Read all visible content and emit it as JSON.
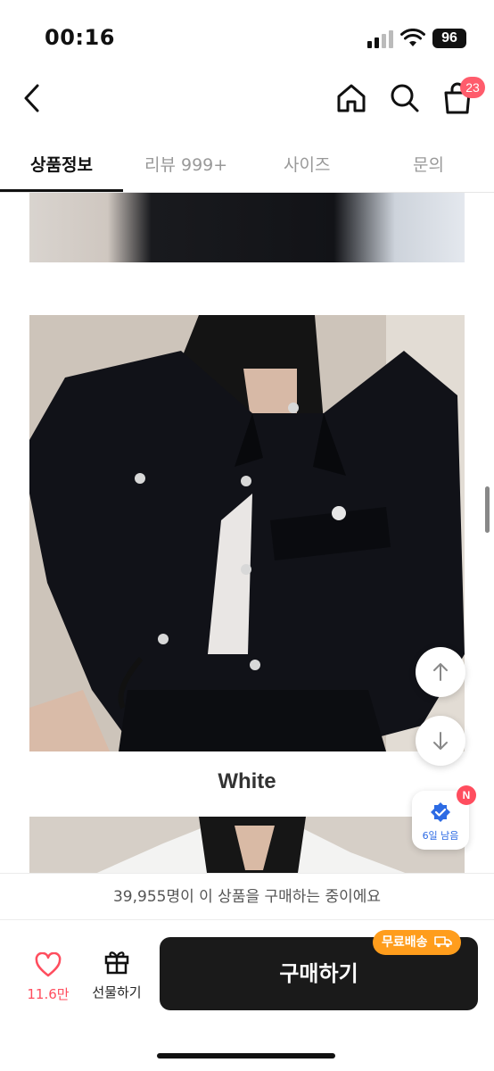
{
  "status_bar": {
    "time": "00:16",
    "battery": "96"
  },
  "header": {
    "cart_count": "23"
  },
  "tabs": [
    {
      "label": "상품정보",
      "active": true
    },
    {
      "label": "리뷰 999+",
      "active": false
    },
    {
      "label": "사이즈",
      "active": false
    },
    {
      "label": "문의",
      "active": false
    }
  ],
  "content": {
    "caption": "White"
  },
  "floating": {
    "coupon_label": "6일 남음",
    "coupon_badge": "N"
  },
  "purchase": {
    "buyers_text": "39,955명이 이 상품을 구매하는 중이에요",
    "like_count": "11.6만",
    "gift_label": "선물하기",
    "buy_label": "구매하기",
    "free_shipping_label": "무료배송"
  },
  "colors": {
    "accent_red": "#ff4d5e",
    "buy_button": "#1a1a1a",
    "free_shipping": "#ff9d1c"
  }
}
